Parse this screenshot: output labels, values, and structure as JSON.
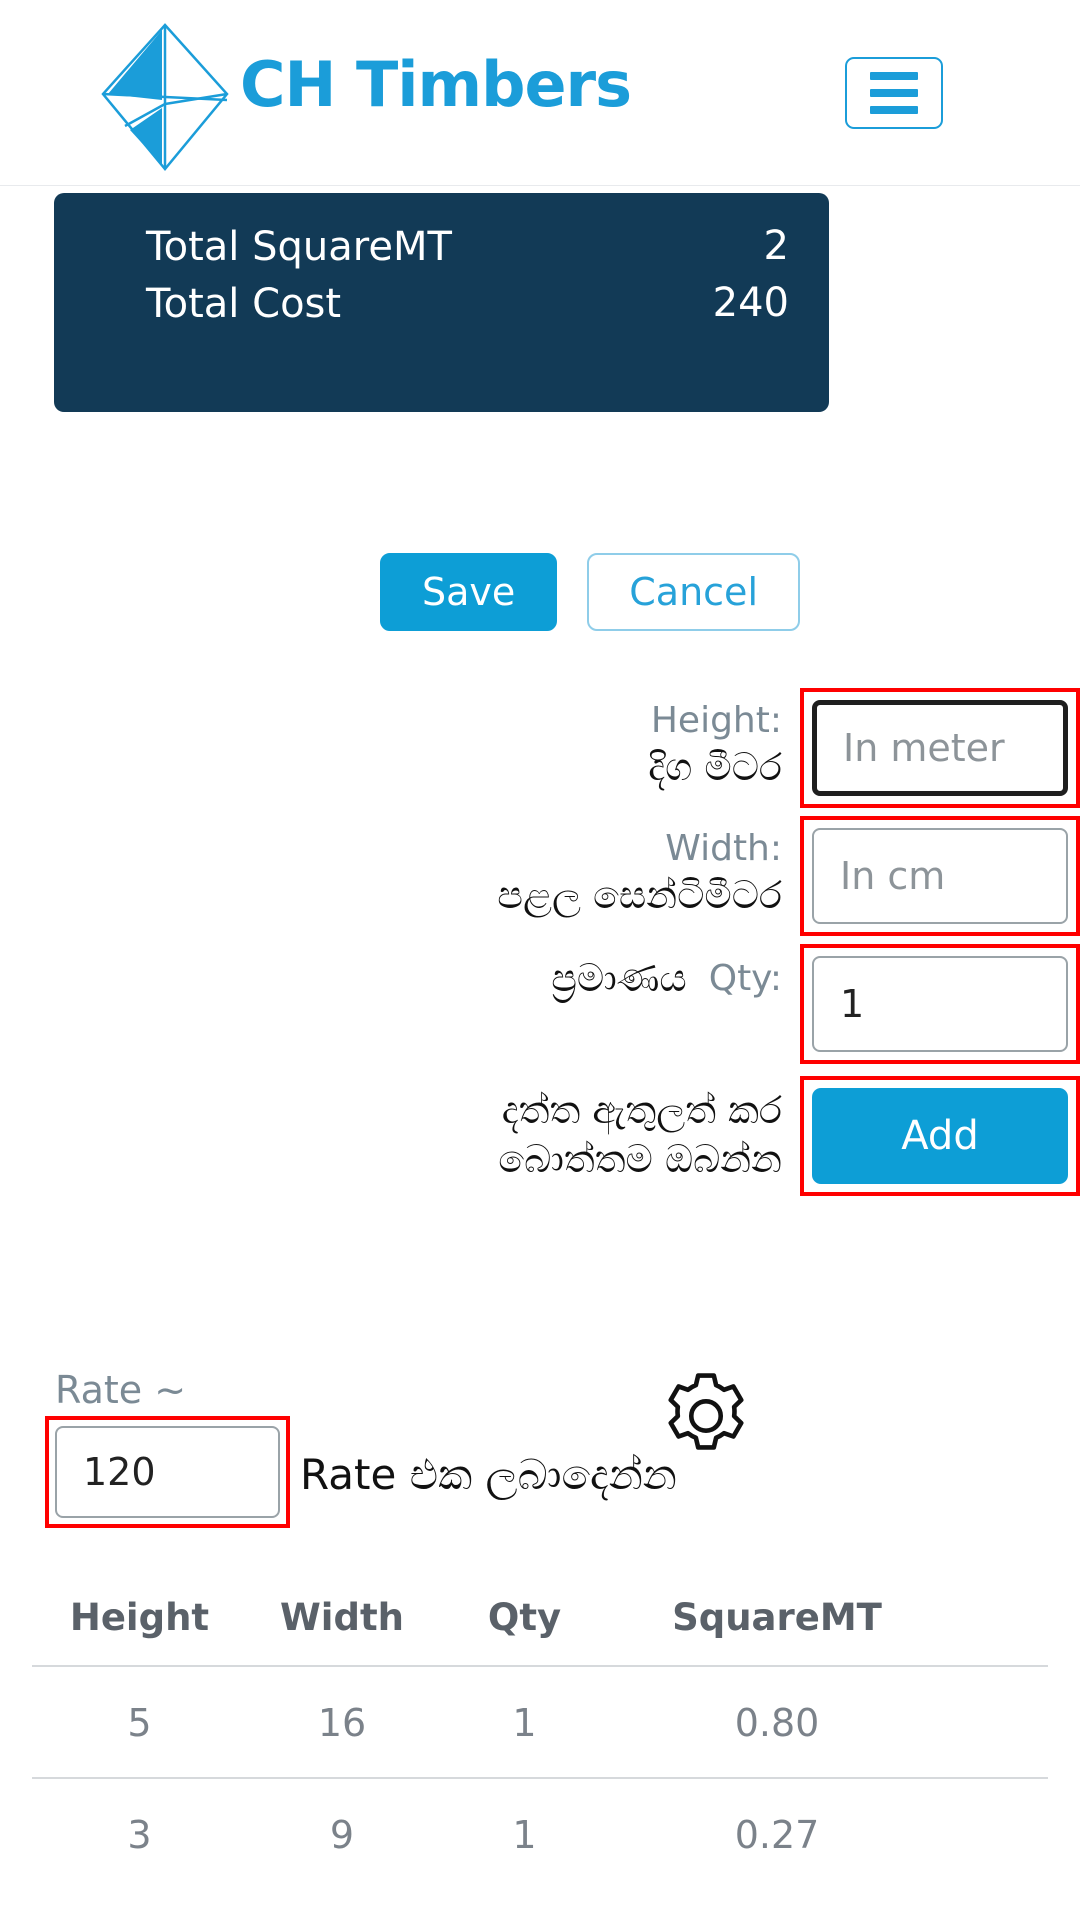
{
  "header": {
    "brand": "CH Timbers",
    "logo_icon": "diamond-logo-icon",
    "menu_icon": "hamburger-menu-icon"
  },
  "totals": {
    "squaremt_label": "Total SquareMT",
    "squaremt_value": "2",
    "cost_label": "Total Cost",
    "cost_value": "240"
  },
  "actions": {
    "save_label": "Save",
    "cancel_label": "Cancel"
  },
  "form": {
    "height": {
      "label_en": "Height:",
      "label_si": "දිග මීටර",
      "placeholder": "In meter",
      "value": ""
    },
    "width": {
      "label_en": "Width:",
      "label_si": "පළල සෙන්ටිමීටර",
      "placeholder": "In cm",
      "value": ""
    },
    "qty": {
      "label_en": "Qty:",
      "label_si": "ප්‍රමාණය",
      "placeholder": "",
      "value": "1"
    },
    "add": {
      "label_si_line1": "දත්ත ඇතුලත් කර",
      "label_si_line2": "බොත්තම ඔබන්න",
      "button_label": "Add"
    }
  },
  "rate": {
    "label": "Rate ~",
    "value": "120",
    "hint_si": "Rate එක ලබාදෙන්න",
    "gear_icon": "gear-settings-icon"
  },
  "table": {
    "columns": [
      "Height",
      "Width",
      "Qty",
      "SquareMT"
    ],
    "rows": [
      [
        "5",
        "16",
        "1",
        "0.80"
      ],
      [
        "3",
        "9",
        "1",
        "0.27"
      ]
    ]
  },
  "colors": {
    "brand_blue": "#1b9dd9",
    "button_blue": "#0d9ed6",
    "panel_navy": "#123a56",
    "annotation_red": "#ff0000",
    "muted_gray": "#7b8a95"
  }
}
